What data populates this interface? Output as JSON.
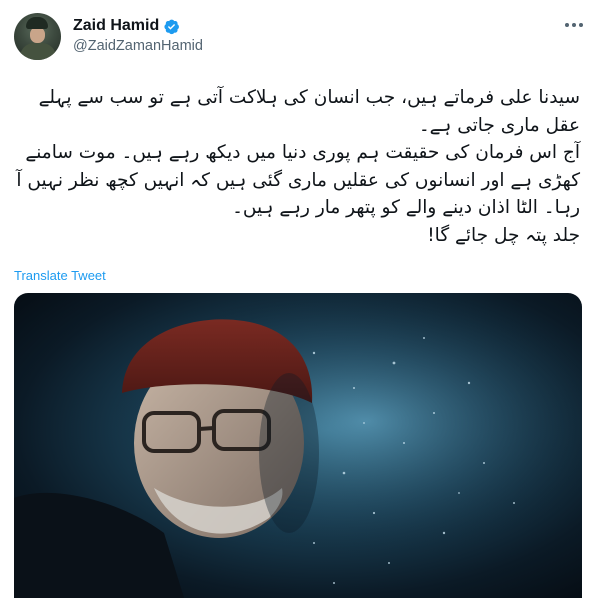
{
  "author": {
    "display_name": "Zaid Hamid",
    "handle": "@ZaidZamanHamid",
    "verified": true
  },
  "tweet": {
    "lines": [
      "سیدنا علی فرماتے ہیں، جب انسان کی ہلاکت آتی ہے تو سب سے پہلے",
      "عقل ماری جاتی ہے۔",
      "آج اس فرمان کی حقیقت ہم پوری دنیا میں دیکھ رہے ہیں۔ موت سامنے",
      "کھڑی ہے اور انسانوں کی عقلیں ماری گئی ہیں کہ انہیں کچھ نظر نہیں آ",
      "رہا۔ الٹا اذان دینے والے کو پتھر مار رہے ہیں۔",
      "جلد پتہ چل جائے گا!"
    ]
  },
  "translate_label": "Translate Tweet",
  "icons": {
    "verified": "verified-badge-icon",
    "more": "more-options-icon"
  },
  "colors": {
    "accent": "#1d9bf0",
    "text": "#0f1419",
    "secondary": "#536471"
  }
}
